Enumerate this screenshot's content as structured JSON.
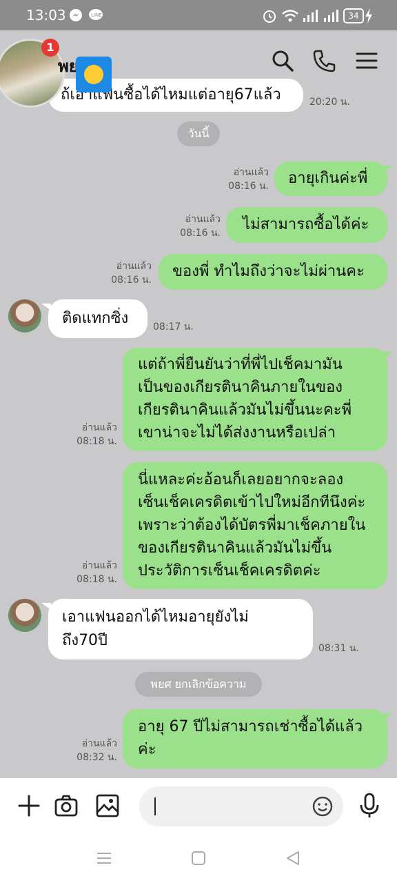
{
  "status_bar": {
    "time": "13:03",
    "battery": "34"
  },
  "header": {
    "contact_name": "พย",
    "unread_badge": "1"
  },
  "messages": [
    {
      "side": "them",
      "text": "ถ้เอาแฟนซื้อได้ไหมแต่อายุ67แล้ว",
      "time": "20:20 น."
    },
    {
      "side": "me",
      "text": "อายุเกินค่ะพี่",
      "read": "อ่านแล้ว",
      "time": "08:16 น."
    },
    {
      "side": "me",
      "text": "ไม่สามารถซื้อได้ค่ะ",
      "read": "อ่านแล้ว",
      "time": "08:16 น."
    },
    {
      "side": "me",
      "text": "ของพี่ ทำไมถึงว่าจะไม่ผ่านคะ",
      "read": "อ่านแล้ว",
      "time": "08:16 น."
    },
    {
      "side": "them",
      "text": "ติดแทกซิ่ง",
      "time": "08:17 น."
    },
    {
      "side": "me",
      "lines": [
        "แต่ถ้าพี่ยืนยันว่าที่พี่ไปเช็คมามัน",
        "เป็นของเกียรตินาคินภายในของ",
        "เกียรตินาคินแล้วมันไม่ขึ้นนะคะพี่",
        "เขาน่าจะไม่ได้ส่งงานหรือเปล่า"
      ],
      "read": "อ่านแล้ว",
      "time": "08:18 น."
    },
    {
      "side": "me",
      "lines": [
        "นี่แหละค่ะอ้อนก็เลยอยากจะลอง",
        "เซ็นเช็คเครดิตเข้าไปใหม่อีกทีนึงค่ะ",
        "เพราะว่าต้องได้บัตรพี่มาเช็คภายใน",
        "ของเกียรตินาคินแล้วมันไม่ขึ้น",
        "ประวัติการเซ็นเช็คเครดิตค่ะ"
      ],
      "read": "อ่านแล้ว",
      "time": "08:18 น."
    },
    {
      "side": "them",
      "lines": [
        "เอาแฟนออกได้ไหมอายุยังไม่",
        "ถึง70ปี"
      ],
      "time": "08:31 น."
    },
    {
      "side": "me",
      "lines": [
        "อายุ 67 ปีไม่สามารถเช่าซื้อได้แล้ว",
        "ค่ะ"
      ],
      "read": "อ่านแล้ว",
      "time": "08:32 น."
    }
  ],
  "date_divider": "วันนี้",
  "system_notice": "พยศ ยกเลิกข้อความ",
  "input": {
    "placeholder": ""
  },
  "colors": {
    "my_bubble": "#9be08b",
    "their_bubble": "#ffffff",
    "chat_bg": "#c9c9cb"
  },
  "icons": [
    "search-icon",
    "phone-icon",
    "menu-icon",
    "plus-icon",
    "camera-icon",
    "image-icon",
    "emoji-icon",
    "mic-icon"
  ]
}
